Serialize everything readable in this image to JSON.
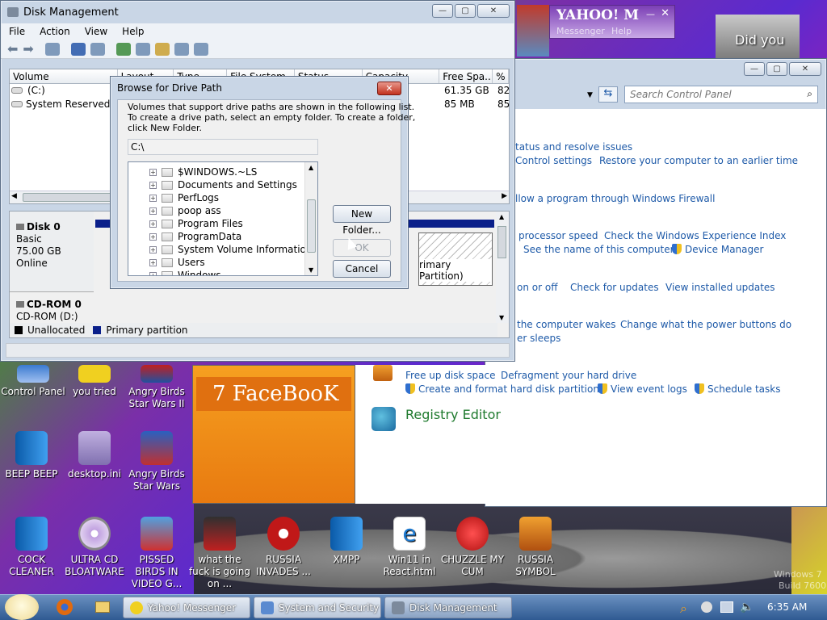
{
  "disk_mgmt": {
    "title": "Disk Management",
    "menu": [
      "File",
      "Action",
      "View",
      "Help"
    ],
    "columns": [
      "Volume",
      "Layout",
      "Type",
      "File System",
      "Status",
      "Capacity",
      "Free Spa...",
      "% F"
    ],
    "rows": [
      {
        "volume": "(C:)",
        "free": "61.35 GB",
        "pct": "82"
      },
      {
        "volume": "System Reserved",
        "free": "85 MB",
        "pct": "85"
      }
    ],
    "disk0": {
      "name": "Disk 0",
      "type": "Basic",
      "size": "75.00 GB",
      "status": "Online"
    },
    "cdrom": {
      "name": "CD-ROM 0",
      "drive": "CD-ROM (D:)"
    },
    "partition_label": "rimary Partition)",
    "legend": {
      "unallocated": "Unallocated",
      "primary": "Primary partition"
    }
  },
  "browse_dialog": {
    "title": "Browse for Drive Path",
    "line1": "Volumes that support drive paths are shown in the following list.",
    "line2": "To create a drive path, select an empty folder. To create a folder,",
    "line3": "click New Folder.",
    "path": "C:\\",
    "folders": [
      "$WINDOWS.~LS",
      "Documents and Settings",
      "PerfLogs",
      "poop ass",
      "Program Files",
      "ProgramData",
      "System Volume Information",
      "Users",
      "Windows"
    ],
    "new_folder": "New Folder...",
    "ok": "OK",
    "cancel": "Cancel"
  },
  "yahoo": {
    "logo": "YAHOO! M",
    "messenger": "Messenger",
    "help": "Help"
  },
  "did_you": "Did you",
  "control_panel": {
    "search_placeholder": "Search Control Panel",
    "links": {
      "l1": "tatus and resolve issues",
      "l2": "Control settings",
      "l3": "Restore your computer to an earlier time",
      "l4": "llow a program through Windows Firewall",
      "l5": "processor speed",
      "l6": "Check the Windows Experience Index",
      "l7": "See the name of this computer",
      "l8": "Device Manager",
      "l9": "on or off",
      "l10": "Check for updates",
      "l11": "View installed updates",
      "l12": "the computer wakes",
      "l13": "Change what the power buttons do",
      "l14": "er sleeps",
      "l15": "Free up disk space",
      "l16": "Defragment your hard drive",
      "l17": "Create and format hard disk partitions",
      "l18": "View event logs",
      "l19": "Schedule tasks"
    },
    "registry": "Registry Editor"
  },
  "facebook_banner": "7 FaceBooK",
  "desktop_icons": [
    {
      "label": "Control Panel"
    },
    {
      "label": "you tried"
    },
    {
      "label": "Angry Birds Star Wars II"
    },
    {
      "label": "BEEP BEEP"
    },
    {
      "label": "desktop.ini"
    },
    {
      "label": "Angry Birds Star Wars"
    },
    {
      "label": "COCK CLEANER"
    },
    {
      "label": "ULTRA CD BLOATWARE"
    },
    {
      "label": "PISSED BIRDS IN VIDEO G..."
    },
    {
      "label": "what the fuck is going on ..."
    },
    {
      "label": "RUSSIA INVADES ..."
    },
    {
      "label": "XMPP"
    },
    {
      "label": "Win11 in React.html"
    },
    {
      "label": "CHUZZLE MY CUM"
    },
    {
      "label": "RUSSIA SYMBOL"
    }
  ],
  "watermark": {
    "line1": "Windows 7",
    "line2": "Build 7600"
  },
  "taskbar": {
    "tasks": [
      "Yahoo! Messenger",
      "System and Security",
      "Disk Management"
    ],
    "clock": "6:35 AM"
  },
  "colors": {
    "accent": "#1e5aa8",
    "primary_partition": "#0a1f8a",
    "unallocated": "#000000"
  }
}
